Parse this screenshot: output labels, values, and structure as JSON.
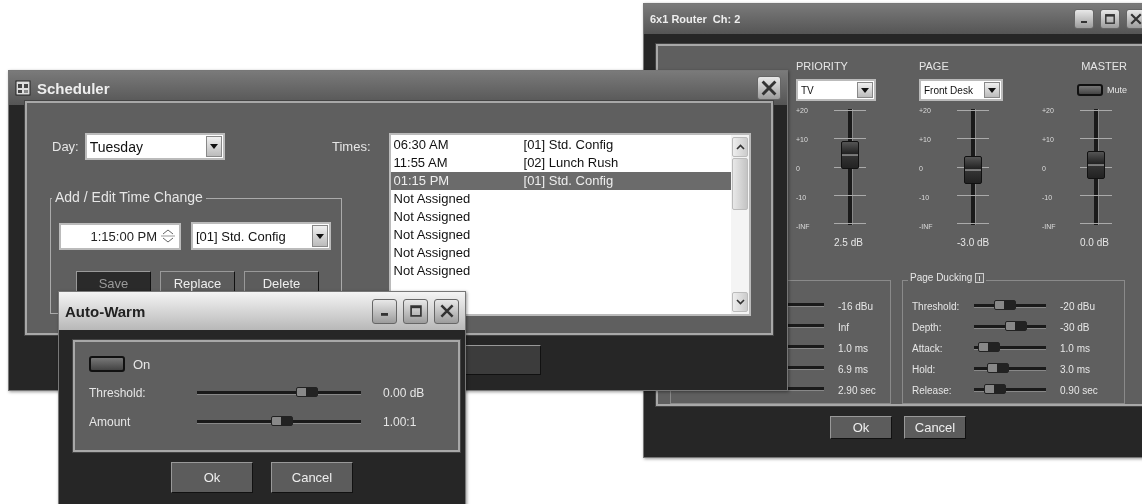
{
  "router": {
    "title": "6x1 Router",
    "channel": "Ch: 2",
    "channels": [
      {
        "kind": "dropdown",
        "heading": "PRIORITY",
        "value": "TV",
        "scale": [
          "+20",
          "+10",
          "0",
          "-10",
          "-INF"
        ],
        "level": 0.6,
        "reading": "2.5 dB"
      },
      {
        "kind": "dropdown",
        "heading": "PAGE",
        "value": "Front Desk",
        "scale": [
          "+20",
          "+10",
          "0",
          "-10",
          "-INF"
        ],
        "level": 0.47,
        "reading": "-3.0 dB"
      },
      {
        "kind": "mute",
        "heading": "MASTER",
        "value": "Mute",
        "on": false,
        "scale": [
          "+20",
          "+10",
          "0",
          "-10",
          "-INF"
        ],
        "level": 0.52,
        "reading": "0.0 dB"
      }
    ],
    "dynamics_readings": [
      "-16 dBu",
      "Inf",
      "1.0 ms",
      "6.9 ms",
      "2.90 sec"
    ],
    "page_ducking": {
      "title": "Page Ducking",
      "rows": [
        {
          "label": "Threshold:",
          "level": 0.4,
          "reading": "-20 dBu"
        },
        {
          "label": "Depth:",
          "level": 0.62,
          "reading": "-30 dB"
        },
        {
          "label": "Attack:",
          "level": 0.08,
          "reading": "1.0 ms"
        },
        {
          "label": "Hold:",
          "level": 0.25,
          "reading": "3.0 ms"
        },
        {
          "label": "Release:",
          "level": 0.2,
          "reading": "0.90 sec"
        }
      ]
    },
    "buttons": [
      "Ok",
      "Cancel"
    ]
  },
  "scheduler": {
    "title": "Scheduler",
    "day_label": "Day:",
    "day": "Tuesday",
    "times_label": "Times:",
    "times": [
      {
        "time": "06:30 AM",
        "preset": "[01] Std. Config",
        "selected": false
      },
      {
        "time": "11:55 AM",
        "preset": "[02] Lunch Rush",
        "selected": false
      },
      {
        "time": "01:15 PM",
        "preset": "[01] Std. Config",
        "selected": true
      },
      {
        "time": "Not Assigned",
        "selected": false
      },
      {
        "time": "Not Assigned",
        "selected": false
      },
      {
        "time": "Not Assigned",
        "selected": false
      },
      {
        "time": "Not Assigned",
        "selected": false
      },
      {
        "time": "Not Assigned",
        "selected": false
      }
    ],
    "group_title": "Add / Edit Time Change",
    "time_value": "1:15:00 PM",
    "preset_value": "[01] Std. Config",
    "buttons": [
      {
        "label": "Save",
        "disabled": true
      },
      {
        "label": "Replace",
        "disabled": false
      },
      {
        "label": "Delete",
        "disabled": false
      }
    ]
  },
  "auto_warm": {
    "title": "Auto-Warm",
    "toggle_label": "On",
    "on": false,
    "rows": [
      {
        "label": "Threshold:",
        "level": 0.7,
        "reading": "0.00 dB"
      },
      {
        "label": "Amount",
        "level": 0.52,
        "reading": "1.00:1"
      }
    ],
    "buttons": [
      "Ok",
      "Cancel"
    ]
  }
}
